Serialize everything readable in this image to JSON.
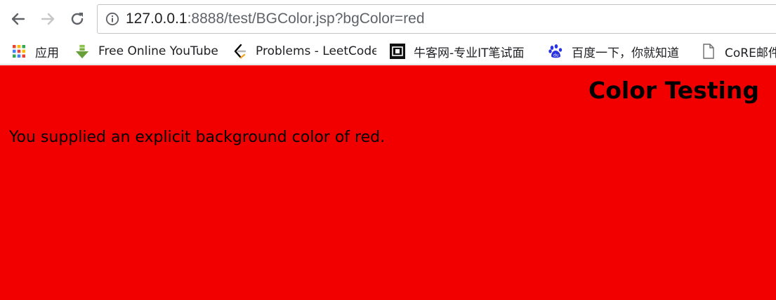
{
  "toolbar": {
    "back_icon": "arrow-left-icon",
    "forward_icon": "arrow-right-icon",
    "reload_icon": "reload-icon",
    "info_icon": "info-circle-icon",
    "url_host": "127.0.0.1",
    "url_rest": ":8888/test/BGColor.jsp?bgColor=red"
  },
  "bookmarks": [
    {
      "icon": "apps-grid-icon",
      "label": "应用"
    },
    {
      "icon": "green-down-arrow-icon",
      "label": "Free Online YouTube"
    },
    {
      "icon": "leetcode-icon",
      "label": "Problems - LeetCode"
    },
    {
      "icon": "nowcoder-icon",
      "label": "牛客网-专业IT笔试面"
    },
    {
      "icon": "baidu-paw-icon",
      "label": "百度一下，你就知道"
    },
    {
      "icon": "document-icon",
      "label": "CoRE邮件"
    }
  ],
  "page": {
    "background_color": "#f20000",
    "title": "Color Testing",
    "text": "You supplied an explicit background color of red."
  }
}
